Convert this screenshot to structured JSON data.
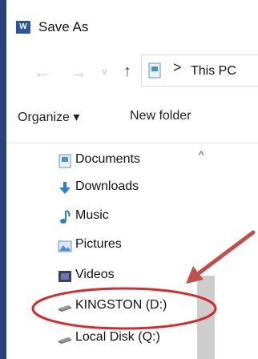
{
  "window": {
    "title": "Save As",
    "app_icon_letter": "W"
  },
  "address_bar": {
    "breadcrumb_separator": ">",
    "path_text": "This PC"
  },
  "toolbar": {
    "organize_label": "Organize ▾",
    "new_folder_label": "New folder"
  },
  "nav_tree": {
    "items": [
      {
        "label": "Documents",
        "icon": "documents-icon"
      },
      {
        "label": "Downloads",
        "icon": "downloads-icon"
      },
      {
        "label": "Music",
        "icon": "music-icon"
      },
      {
        "label": "Pictures",
        "icon": "pictures-icon"
      },
      {
        "label": "Videos",
        "icon": "videos-icon"
      },
      {
        "label": "KINGSTON (D:)",
        "icon": "usb-drive-icon"
      },
      {
        "label": "Local Disk (Q:)",
        "icon": "local-disk-icon"
      }
    ]
  },
  "annotation": {
    "arrow_color": "#c0504d",
    "circle_color": "#d42b2b"
  }
}
